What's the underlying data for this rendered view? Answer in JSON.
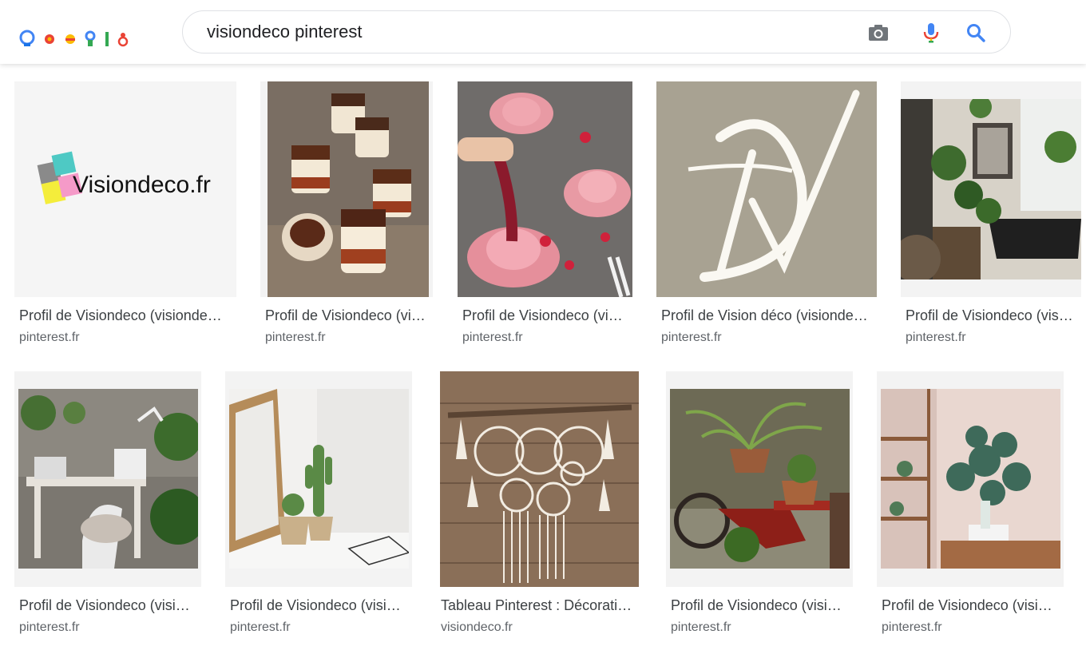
{
  "search": {
    "query": "visiondeco pinterest"
  },
  "results": [
    {
      "title": "Profil de Visiondeco (visionde…",
      "source": "pinterest.fr",
      "logo_text": "Visiondeco.fr"
    },
    {
      "title": "Profil de Visiondeco (vi…",
      "source": "pinterest.fr"
    },
    {
      "title": "Profil de Visiondeco (vi…",
      "source": "pinterest.fr"
    },
    {
      "title": "Profil de Vision déco (visionde…",
      "source": "pinterest.fr"
    },
    {
      "title": "Profil de Visiondeco (vis…",
      "source": "pinterest.fr"
    },
    {
      "title": "Profil de Visiondeco (visi…",
      "source": "pinterest.fr"
    },
    {
      "title": "Profil de Visiondeco (visi…",
      "source": "pinterest.fr"
    },
    {
      "title": "Tableau Pinterest : Décorati…",
      "source": "visiondeco.fr"
    },
    {
      "title": "Profil de Visiondeco (visi…",
      "source": "pinterest.fr"
    },
    {
      "title": "Profil de Visiondeco (visi…",
      "source": "pinterest.fr"
    }
  ],
  "icons": {
    "camera": "camera-icon",
    "mic": "microphone-icon",
    "search": "search-icon"
  },
  "colors": {
    "google_blue": "#4285f4",
    "google_red": "#ea4335",
    "google_yellow": "#fbbc05",
    "google_green": "#34a853",
    "title_text": "#3c4043",
    "source_text": "#5f6368"
  }
}
